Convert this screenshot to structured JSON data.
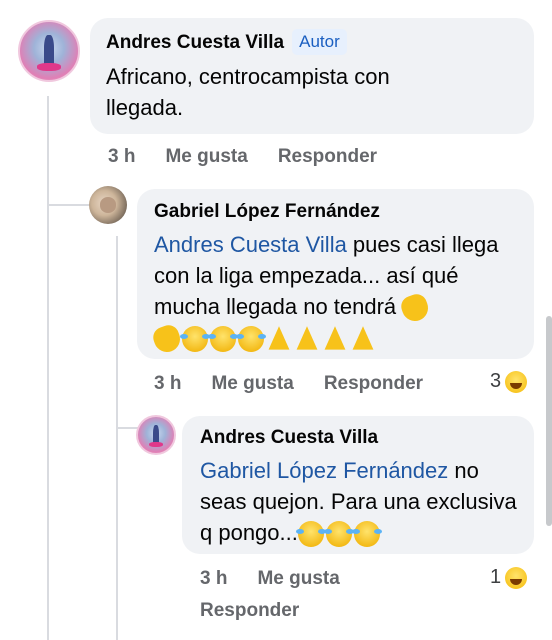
{
  "comments": [
    {
      "author": "Andres Cuesta Villa",
      "badge": "Autor",
      "text": "Africano, centrocampista con llegada.",
      "time": "3 h",
      "like_label": "Me gusta",
      "reply_label": "Responder"
    },
    {
      "author": "Gabriel López Fernández",
      "mention": "Andres Cuesta Villa",
      "text": " pues casi llega con la liga empezada... así qué mucha llegada no tendrá",
      "emojis": [
        "clapping-hands",
        "clapping-hands",
        "face-with-tears-of-joy",
        "face-with-tears-of-joy",
        "face-with-tears-of-joy",
        "folded-hands",
        "folded-hands",
        "folded-hands",
        "folded-hands"
      ],
      "time": "3 h",
      "like_label": "Me gusta",
      "reply_label": "Responder",
      "reaction_count": "3",
      "reaction_icon": "laughing-reaction-icon"
    },
    {
      "author": "Andres Cuesta Villa",
      "mention": "Gabriel López Fernández",
      "text": " no seas quejon. Para una exclusiva q pongo...",
      "emojis": [
        "face-with-tears-of-joy",
        "face-with-tears-of-joy",
        "face-with-tears-of-joy"
      ],
      "time": "3 h",
      "like_label": "Me gusta",
      "reply_label": "Responder",
      "reaction_count": "1",
      "reaction_icon": "laughing-reaction-icon"
    }
  ],
  "colors": {
    "bubble": "#f0f2f5",
    "mention": "#1f57a3",
    "badge_bg": "#e7f0fd",
    "badge_text": "#1b5fc1",
    "meta": "#65676b"
  }
}
